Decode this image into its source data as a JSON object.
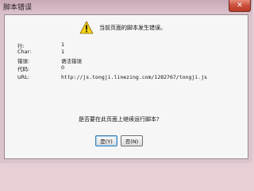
{
  "window": {
    "title": "脚本错误",
    "close_glyph": "✕"
  },
  "dialog": {
    "icon": "warning-icon",
    "headline": "当前页面的脚本发生错误。",
    "details": [
      {
        "key": "行:",
        "value": "1"
      },
      {
        "key": "Char:",
        "value": "1"
      },
      {
        "key": "错误:",
        "value": "语法错误"
      },
      {
        "key": "代码:",
        "value": "0"
      },
      {
        "key": "URL:",
        "value": "http://js.tongji.linezing.com/1282767/tongji.js"
      }
    ],
    "question": "是否要在此页面上继续运行脚本?",
    "buttons": {
      "yes": "是(Y)",
      "no": "否(N)"
    }
  },
  "colors": {
    "warning_yellow": "#f7d117",
    "title_tint": "#d8bec8",
    "close_red": "#c9503c"
  }
}
